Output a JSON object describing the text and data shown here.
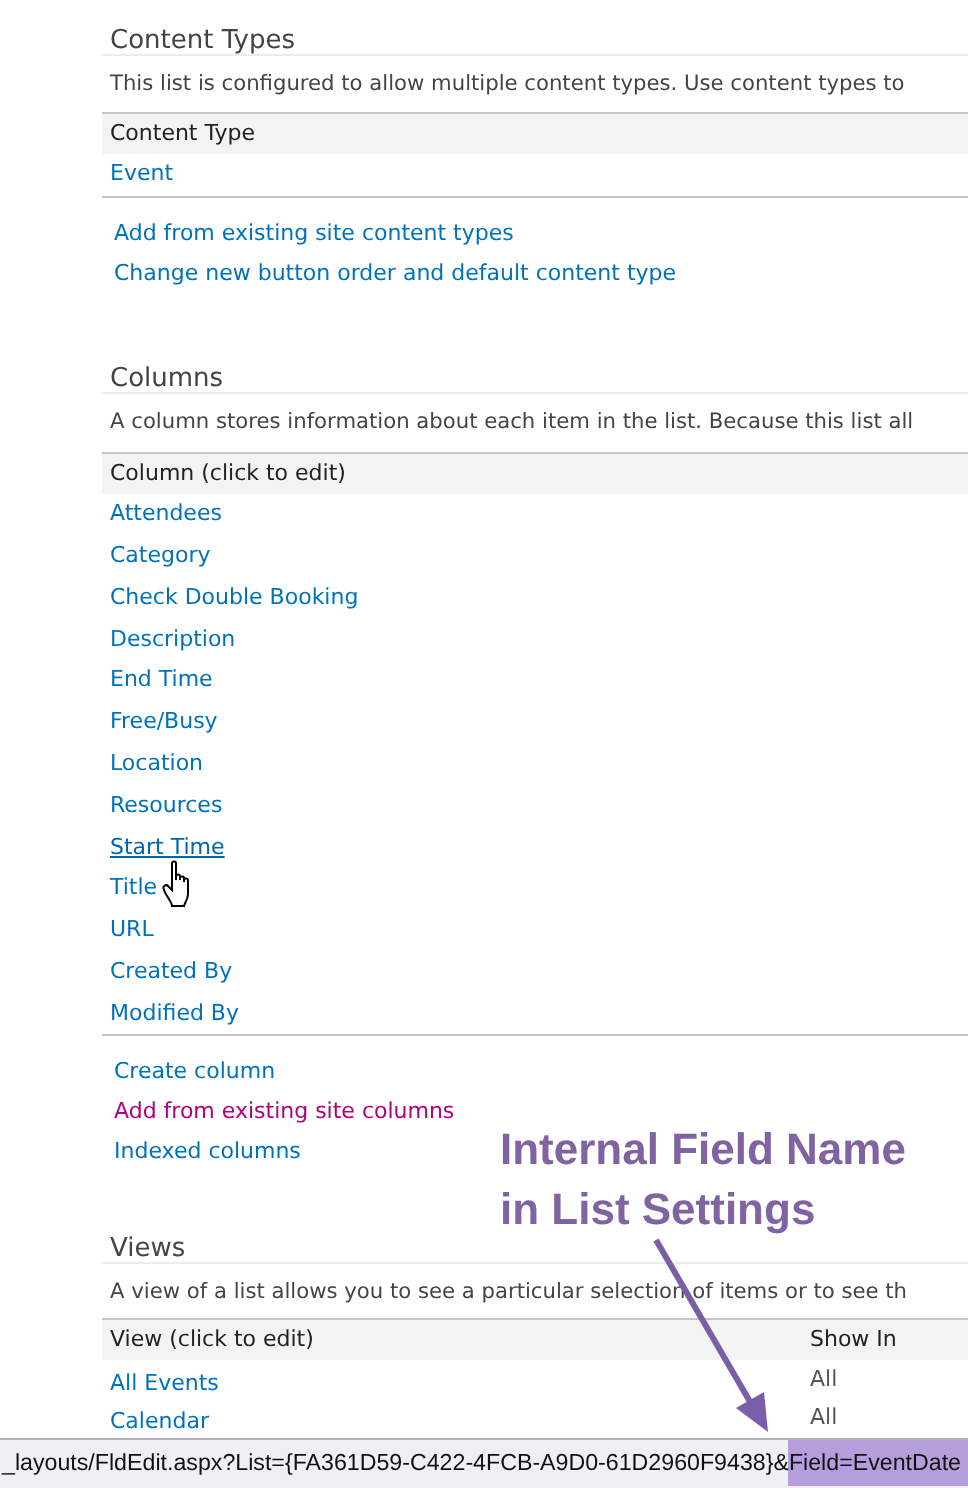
{
  "content_types": {
    "heading": "Content Types",
    "description": "This list is configured to allow multiple content types. Use content types to",
    "header": "Content Type",
    "rows": [
      "Event"
    ],
    "links": [
      {
        "label": "Add from existing site content types",
        "visited": false
      },
      {
        "label": "Change new button order and default content type",
        "visited": false
      }
    ]
  },
  "columns": {
    "heading": "Columns",
    "description": "A column stores information about each item in the list. Because this list all",
    "header": "Column (click to edit)",
    "items": [
      {
        "label": "Attendees",
        "hovered": false
      },
      {
        "label": "Category",
        "hovered": false
      },
      {
        "label": "Check Double Booking",
        "hovered": false
      },
      {
        "label": "Description",
        "hovered": false
      },
      {
        "label": "End Time",
        "hovered": false
      },
      {
        "label": "Free/Busy",
        "hovered": false
      },
      {
        "label": "Location",
        "hovered": false
      },
      {
        "label": "Resources",
        "hovered": false
      },
      {
        "label": "Start Time",
        "hovered": true
      },
      {
        "label": "Title",
        "hovered": false
      },
      {
        "label": "URL",
        "hovered": false
      },
      {
        "label": "Created By",
        "hovered": false
      },
      {
        "label": "Modified By",
        "hovered": false
      }
    ],
    "links": [
      {
        "label": "Create column",
        "visited": false
      },
      {
        "label": "Add from existing site columns",
        "visited": true
      },
      {
        "label": "Indexed columns",
        "visited": false
      }
    ]
  },
  "views": {
    "heading": "Views",
    "description": "A view of a list allows you to see a particular selection of items or to see th",
    "columns": [
      "View (click to edit)",
      "Show In"
    ],
    "rows": [
      {
        "view": "All Events",
        "show_in": "All"
      },
      {
        "view": "Calendar",
        "show_in": "All"
      }
    ]
  },
  "annotation": {
    "lines": [
      "Internal Field Name",
      "in List Settings"
    ]
  },
  "status_bar": {
    "url": "_layouts/FldEdit.aspx?List={FA361D59-C422-4FCB-A9D0-61D2960F9438}&",
    "highlighted": "Field=EventDate"
  }
}
